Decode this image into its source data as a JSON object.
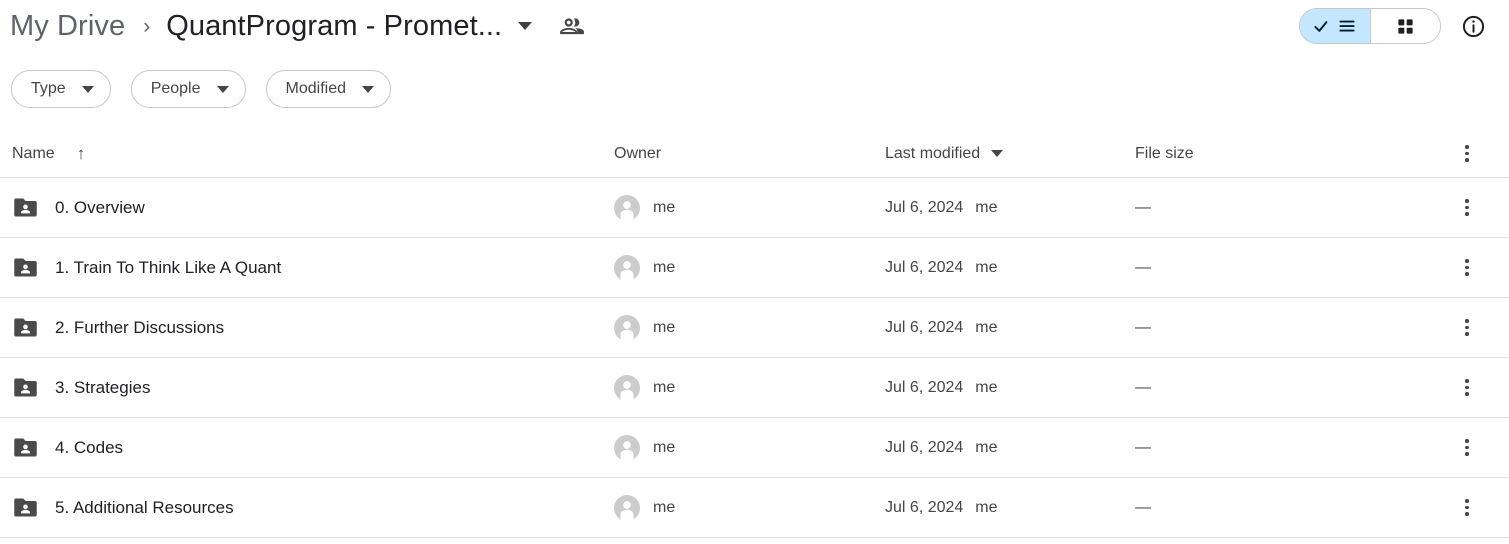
{
  "header": {
    "breadcrumb_root": "My Drive",
    "breadcrumb_separator": "›",
    "breadcrumb_current": "QuantProgram - Promet...",
    "people_icon": "people-shared-icon",
    "title_caret_icon": "chevron-down-icon",
    "view_list_icon": "check-list-view-icon",
    "view_grid_icon": "grid-view-icon",
    "info_icon": "info-circle-icon",
    "active_view": "list",
    "accent_color": "#c2e7ff",
    "text_color": "#202124",
    "secondary_text_color": "#444746",
    "border_color": "#c4c7c5"
  },
  "filters": [
    {
      "label": "Type",
      "icon": "chevron-down-icon"
    },
    {
      "label": "People",
      "icon": "chevron-down-icon"
    },
    {
      "label": "Modified",
      "icon": "chevron-down-icon"
    }
  ],
  "table": {
    "columns": {
      "name": "Name",
      "sort_arrow": "↑",
      "owner": "Owner",
      "last_modified": "Last modified",
      "file_size": "File size"
    },
    "header_menu_icon": "more-vertical-icon",
    "rows": [
      {
        "name": "0. Overview",
        "icon": "shared-folder-icon",
        "owner": "me",
        "owner_avatar": "person-avatar-icon",
        "modified_date": "Jul 6, 2024",
        "modified_by": "me",
        "size": "—",
        "menu_icon": "more-vertical-icon"
      },
      {
        "name": "1. Train To Think Like A Quant",
        "icon": "shared-folder-icon",
        "owner": "me",
        "owner_avatar": "person-avatar-icon",
        "modified_date": "Jul 6, 2024",
        "modified_by": "me",
        "size": "—",
        "menu_icon": "more-vertical-icon"
      },
      {
        "name": "2. Further Discussions",
        "icon": "shared-folder-icon",
        "owner": "me",
        "owner_avatar": "person-avatar-icon",
        "modified_date": "Jul 6, 2024",
        "modified_by": "me",
        "size": "—",
        "menu_icon": "more-vertical-icon"
      },
      {
        "name": "3. Strategies",
        "icon": "shared-folder-icon",
        "owner": "me",
        "owner_avatar": "person-avatar-icon",
        "modified_date": "Jul 6, 2024",
        "modified_by": "me",
        "size": "—",
        "menu_icon": "more-vertical-icon"
      },
      {
        "name": "4. Codes",
        "icon": "shared-folder-icon",
        "owner": "me",
        "owner_avatar": "person-avatar-icon",
        "modified_date": "Jul 6, 2024",
        "modified_by": "me",
        "size": "—",
        "menu_icon": "more-vertical-icon"
      },
      {
        "name": "5. Additional Resources",
        "icon": "shared-folder-icon",
        "owner": "me",
        "owner_avatar": "person-avatar-icon",
        "modified_date": "Jul 6, 2024",
        "modified_by": "me",
        "size": "—",
        "menu_icon": "more-vertical-icon"
      }
    ]
  }
}
